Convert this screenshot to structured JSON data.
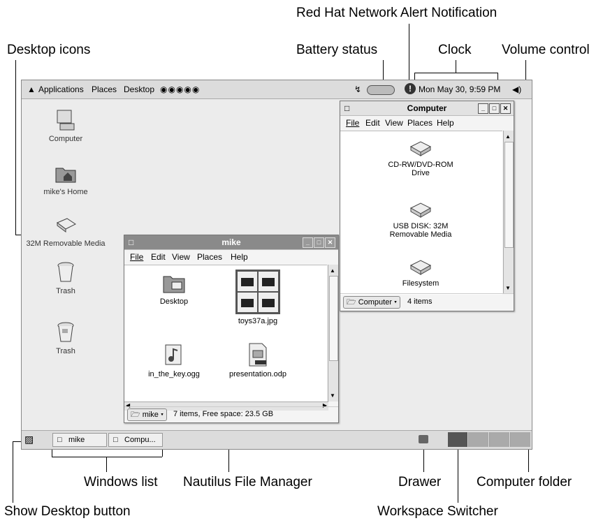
{
  "callouts": {
    "red_hat_network": "Red Hat Network Alert Notification",
    "desktop_icons": "Desktop icons",
    "battery_status": "Battery status",
    "clock": "Clock",
    "volume_control": "Volume control",
    "windows_list": "Windows list",
    "nautilus": "Nautilus File Manager",
    "drawer": "Drawer",
    "computer_folder": "Computer folder",
    "show_desktop": "Show Desktop button",
    "workspace_switcher": "Workspace Switcher"
  },
  "top_panel": {
    "menus": [
      "Applications",
      "Places",
      "Desktop"
    ],
    "clock": "Mon May 30,  9:59 PM"
  },
  "desktop_icons": [
    {
      "label": "Computer",
      "icon": "computer-icon"
    },
    {
      "label": "mike's Home",
      "icon": "home-folder-icon"
    },
    {
      "label": "32M Removable Media",
      "icon": "removable-media-icon"
    },
    {
      "label": "Trash",
      "icon": "trash-icon"
    },
    {
      "label": "Trash",
      "icon": "trash-full-icon"
    }
  ],
  "computer_window": {
    "title": "Computer",
    "menu": [
      "File",
      "Edit",
      "View",
      "Places",
      "Help"
    ],
    "items": [
      {
        "label": "CD-RW/DVD-ROM\nDrive",
        "icon": "cdrom-drive-icon"
      },
      {
        "label": "USB DISK: 32M\nRemovable Media",
        "icon": "usb-disk-icon"
      },
      {
        "label": "Filesystem",
        "icon": "filesystem-icon"
      }
    ],
    "location": "Computer",
    "status": "4 items"
  },
  "mike_window": {
    "title": "mike",
    "menu": [
      "File",
      "Edit",
      "View",
      "Places",
      "Help"
    ],
    "items": [
      {
        "label": "Desktop",
        "icon": "desktop-folder-icon"
      },
      {
        "label": "toys37a.jpg",
        "icon": "image-thumbnail-icon"
      },
      {
        "label": "in_the_key.ogg",
        "icon": "audio-file-icon"
      },
      {
        "label": "presentation.odp",
        "icon": "presentation-file-icon"
      }
    ],
    "location": "mike",
    "status": "7 items, Free space: 23.5 GB"
  },
  "taskbar": {
    "tasks": [
      "mike",
      "Compu..."
    ]
  }
}
